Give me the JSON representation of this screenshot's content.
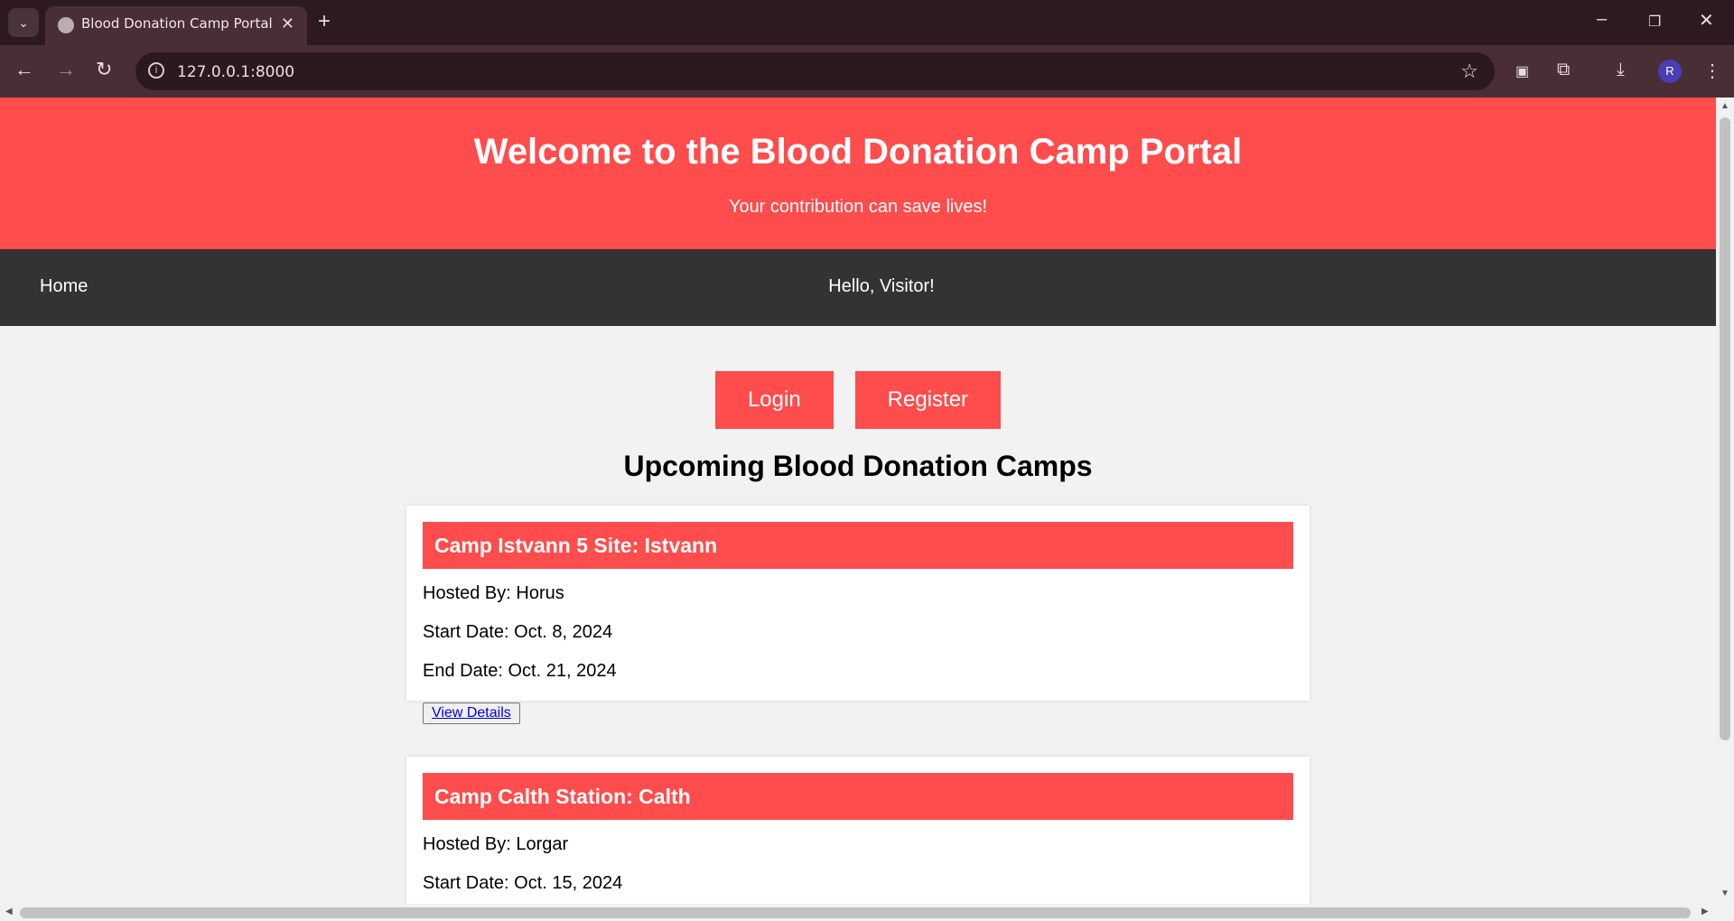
{
  "browser": {
    "tab_title": "Blood Donation Camp Portal",
    "url": "127.0.0.1:8000",
    "profile_initial": "R"
  },
  "header": {
    "title": "Welcome to the Blood Donation Camp Portal",
    "subtitle": "Your contribution can save lives!"
  },
  "nav": {
    "home_label": "Home",
    "greeting": "Hello, Visitor!"
  },
  "actions": {
    "login_label": "Login",
    "register_label": "Register"
  },
  "camps_section": {
    "title": "Upcoming Blood Donation Camps",
    "camps": [
      {
        "name": "Camp Istvann 5 Site: Istvann",
        "hosted_by": "Hosted By: Horus",
        "start_date": "Start Date: Oct. 8, 2024",
        "end_date": "End Date: Oct. 21, 2024",
        "details_label": "View Details"
      },
      {
        "name": "Camp Calth Station: Calth",
        "hosted_by": "Hosted By: Lorgar",
        "start_date": "Start Date: Oct. 15, 2024"
      }
    ]
  },
  "colors": {
    "accent": "#ff4c4c",
    "navbar": "#333333",
    "page_background": "#f2f2f2"
  },
  "icons": [
    "tab-search-icon",
    "globe-icon",
    "close-icon",
    "plus-icon",
    "back-icon",
    "forward-icon",
    "reload-icon",
    "info-icon",
    "star-icon",
    "extension-icon",
    "download-icon",
    "more-icon"
  ]
}
